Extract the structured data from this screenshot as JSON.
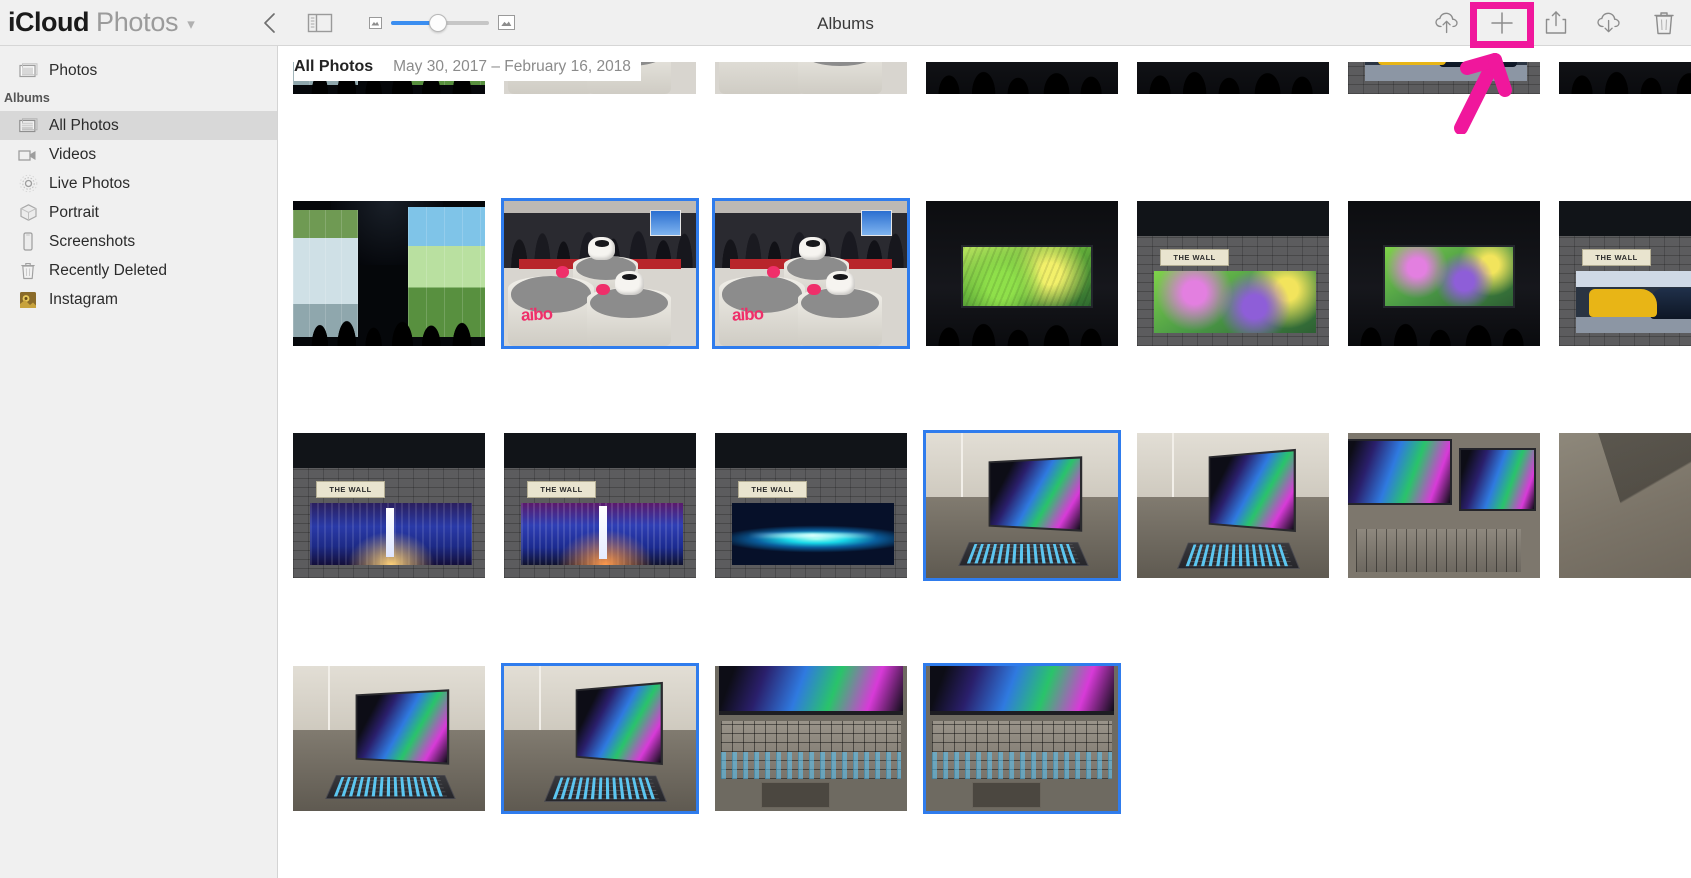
{
  "app": {
    "brand_primary": "iCloud",
    "brand_secondary": "Photos",
    "brand_chevron": "⌄",
    "window_title": "Albums"
  },
  "toolbar": {
    "back_icon": "chevron-left-icon",
    "sidebar_toggle_icon": "sidebar-toggle-icon",
    "zoom_small_icon": "small-thumbnail-icon",
    "zoom_large_icon": "large-thumbnail-icon",
    "zoom_value_percent": 50,
    "right_actions": [
      {
        "name": "upload-button",
        "icon": "cloud-upload-icon",
        "highlighted": false
      },
      {
        "name": "add-button",
        "icon": "plus-icon",
        "highlighted": false
      },
      {
        "name": "share-button",
        "icon": "share-icon",
        "highlighted": false
      },
      {
        "name": "download-button",
        "icon": "cloud-download-icon",
        "highlighted": true
      },
      {
        "name": "delete-button",
        "icon": "trash-icon",
        "highlighted": false
      }
    ]
  },
  "annotation": {
    "highlight_color": "#f0179c",
    "target": "download-button",
    "shape": "rectangle-with-arrow"
  },
  "sidebar": {
    "top_items": [
      {
        "label": "Photos",
        "icon": "photos-icon",
        "selected": false
      }
    ],
    "section_header": "Albums",
    "items": [
      {
        "label": "All Photos",
        "icon": "photos-stack-icon",
        "selected": true
      },
      {
        "label": "Videos",
        "icon": "video-camera-icon",
        "selected": false
      },
      {
        "label": "Live Photos",
        "icon": "live-photo-icon",
        "selected": false
      },
      {
        "label": "Portrait",
        "icon": "cube-icon",
        "selected": false
      },
      {
        "label": "Screenshots",
        "icon": "phone-icon",
        "selected": false
      },
      {
        "label": "Recently Deleted",
        "icon": "trash-icon",
        "selected": false
      },
      {
        "label": "Instagram",
        "icon": "album-thumbnail-icon",
        "selected": false
      }
    ]
  },
  "content": {
    "header_title": "All Photos",
    "date_range": "May 30, 2017 – February 16, 2018",
    "selection_color": "#2f7ced",
    "rows": [
      {
        "partial": true,
        "cells": [
          {
            "art": "art-room",
            "alt": "immersive-waterfall-display-room",
            "selected": false
          },
          {
            "art": "art-aibo",
            "alt": "aibo-robot-dogs-booth",
            "selected": false
          },
          {
            "art": "art-aibo",
            "alt": "aibo-robot-dogs-booth",
            "selected": false
          },
          {
            "art": "wall-tv",
            "alt": "the-wall-display-dark-room",
            "selected": false
          },
          {
            "art": "wall-garden",
            "alt": "the-wall-garden-display",
            "selected": false
          },
          {
            "art": "wall-car",
            "alt": "the-wall-racecar-display",
            "selected": false
          },
          {
            "art": "wall-tv",
            "alt": "the-wall-display-dark-room",
            "selected": false
          }
        ]
      },
      {
        "partial": false,
        "cells": [
          {
            "art": "art-room",
            "alt": "immersive-waterfall-display-room",
            "selected": false
          },
          {
            "art": "art-aibo",
            "alt": "aibo-robot-dogs-booth",
            "selected": true
          },
          {
            "art": "art-aibo",
            "alt": "aibo-robot-dogs-booth",
            "selected": true
          },
          {
            "art": "wall-tv",
            "alt": "the-wall-display-dark-room",
            "selected": false
          },
          {
            "art": "wall-garden",
            "alt": "the-wall-garden-display",
            "selected": false
          },
          {
            "art": "wall-car",
            "alt": "the-wall-racecar-display",
            "selected": false
          },
          {
            "art": "wall-tv",
            "alt": "the-wall-display-dark-room",
            "selected": false
          }
        ]
      },
      {
        "partial": false,
        "cells": [
          {
            "art": "wall-city",
            "alt": "the-wall-cityscape-display",
            "selected": false
          },
          {
            "art": "wall-city2",
            "alt": "the-wall-cityscape-display",
            "selected": false
          },
          {
            "art": "wall-plasma",
            "alt": "the-wall-plasma-display",
            "selected": false
          },
          {
            "art": "art-lap",
            "alt": "razer-laptop-on-desk",
            "selected": true
          },
          {
            "art": "art-lap2",
            "alt": "razer-laptop-on-desk",
            "selected": false
          },
          {
            "art": "art-dual",
            "alt": "two-razer-laptops-on-desk",
            "selected": false
          },
          {
            "art": "art-cloth",
            "alt": "laptop-bag-closeup",
            "selected": false
          }
        ]
      },
      {
        "partial": false,
        "cells": [
          {
            "art": "art-lap",
            "alt": "razer-laptop-on-desk",
            "selected": false
          },
          {
            "art": "art-lap2",
            "alt": "razer-laptop-on-desk",
            "selected": true
          },
          {
            "art": "art-kb",
            "alt": "razer-laptop-keyboard",
            "selected": false
          },
          {
            "art": "art-kb",
            "alt": "razer-laptop-keyboard",
            "selected": true
          }
        ]
      }
    ],
    "wall_sign_text": "THE WALL"
  }
}
